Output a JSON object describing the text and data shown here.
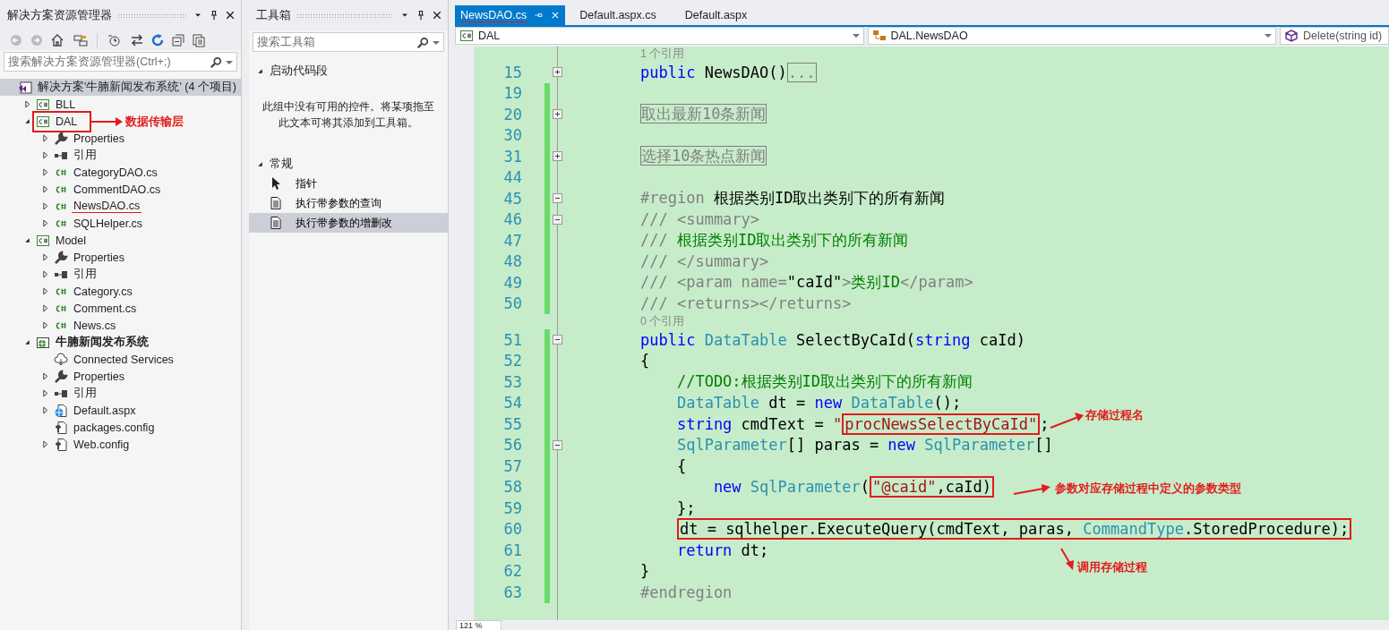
{
  "solution_explorer": {
    "title": "解决方案资源管理器",
    "search": {
      "placeholder": "搜索解决方案资源管理器(Ctrl+;)"
    },
    "tree": [
      {
        "label": "解决方案'牛腩新闻发布系统' (4 个项目)",
        "kind": "solution",
        "selected": true,
        "children": [
          {
            "label": "BLL",
            "kind": "csproj",
            "expanded": false
          },
          {
            "label": "DAL",
            "kind": "csproj",
            "expanded": true,
            "boxed": true,
            "children": [
              {
                "label": "Properties",
                "kind": "wrench",
                "expanded": false
              },
              {
                "label": "引用",
                "kind": "reference",
                "expanded": false
              },
              {
                "label": "CategoryDAO.cs",
                "kind": "csfile",
                "expanded": false
              },
              {
                "label": "CommentDAO.cs",
                "kind": "csfile",
                "expanded": false
              },
              {
                "label": "NewsDAO.cs",
                "kind": "csfile",
                "expanded": false,
                "underlined": true
              },
              {
                "label": "SQLHelper.cs",
                "kind": "csfile",
                "expanded": false
              }
            ]
          },
          {
            "label": "Model",
            "kind": "csproj",
            "expanded": true,
            "children": [
              {
                "label": "Properties",
                "kind": "wrench",
                "expanded": false
              },
              {
                "label": "引用",
                "kind": "reference",
                "expanded": false
              },
              {
                "label": "Category.cs",
                "kind": "csfile",
                "expanded": false
              },
              {
                "label": "Comment.cs",
                "kind": "csfile",
                "expanded": false
              },
              {
                "label": "News.cs",
                "kind": "csfile",
                "expanded": false
              }
            ]
          },
          {
            "label": "牛腩新闻发布系统",
            "kind": "webproj",
            "expanded": true,
            "bold": true,
            "children": [
              {
                "label": "Connected Services",
                "kind": "cloud"
              },
              {
                "label": "Properties",
                "kind": "wrench",
                "expanded": false
              },
              {
                "label": "引用",
                "kind": "reference",
                "expanded": false
              },
              {
                "label": "Default.aspx",
                "kind": "webfile",
                "expanded": false
              },
              {
                "label": "packages.config",
                "kind": "config"
              },
              {
                "label": "Web.config",
                "kind": "config",
                "expanded": false
              }
            ]
          }
        ]
      }
    ]
  },
  "toolbox": {
    "title": "工具箱",
    "search": {
      "placeholder": "搜索工具箱"
    },
    "groups": [
      {
        "label": "启动代码段",
        "expanded": true,
        "message": "此组中没有可用的控件。将某项拖至此文本可将其添加到工具箱。"
      },
      {
        "label": "常规",
        "expanded": true,
        "items": [
          {
            "label": "指针",
            "kind": "pointer",
            "selected": false
          },
          {
            "label": "执行带参数的查询",
            "kind": "snippet",
            "selected": false
          },
          {
            "label": "执行带参数的增删改",
            "kind": "snippet",
            "selected": true
          }
        ]
      }
    ]
  },
  "editor": {
    "tabs": [
      {
        "label": "NewsDAO.cs",
        "selected": true,
        "underlined": true
      },
      {
        "label": "Default.aspx.cs",
        "selected": false
      },
      {
        "label": "Default.aspx",
        "selected": false
      }
    ],
    "navigation": [
      {
        "kind": "project",
        "text": "DAL"
      },
      {
        "kind": "class",
        "text": "DAL.NewsDAO"
      },
      {
        "kind": "member",
        "text": "Delete(string id)"
      }
    ],
    "lines": [
      {
        "kind": "hint",
        "text": "1 个引用"
      },
      {
        "kind": "code",
        "number": "15",
        "expanded": false,
        "changed": false,
        "segments": [
          {
            "kind": "kw",
            "text": "public "
          },
          {
            "kind": "plain",
            "text": "NewsDAO()"
          },
          {
            "kind": "collapsed",
            "text": "..."
          }
        ]
      },
      {
        "kind": "code",
        "number": "19",
        "changed": true
      },
      {
        "kind": "code",
        "number": "20",
        "expanded": false,
        "changed": true,
        "segments": [
          {
            "kind": "collapsed",
            "text": "取出最新10条新闻"
          }
        ]
      },
      {
        "kind": "code",
        "number": "30",
        "changed": true
      },
      {
        "kind": "code",
        "number": "31",
        "expanded": false,
        "changed": true,
        "segments": [
          {
            "kind": "collapsed",
            "text": "选择10条热点新闻"
          }
        ]
      },
      {
        "kind": "code",
        "number": "44",
        "changed": true
      },
      {
        "kind": "code",
        "number": "45",
        "expanded": true,
        "changed": true,
        "segments": [
          {
            "kind": "gray",
            "text": "#region "
          },
          {
            "kind": "plain",
            "text": "根据类别ID取出类别下的所有新闻"
          }
        ]
      },
      {
        "kind": "code",
        "number": "46",
        "expanded": true,
        "changed": true,
        "segments": [
          {
            "kind": "gray",
            "text": "/// <summary>"
          }
        ]
      },
      {
        "kind": "code",
        "number": "47",
        "changed": true,
        "segments": [
          {
            "kind": "gray",
            "text": "/// "
          },
          {
            "kind": "comment",
            "text": "根据类别ID取出类别下的所有新闻"
          }
        ]
      },
      {
        "kind": "code",
        "number": "48",
        "changed": true,
        "segments": [
          {
            "kind": "gray",
            "text": "/// </summary>"
          }
        ]
      },
      {
        "kind": "code",
        "number": "49",
        "changed": true,
        "segments": [
          {
            "kind": "gray",
            "text": "/// <param name="
          },
          {
            "kind": "plain",
            "text": "\"caId\""
          },
          {
            "kind": "gray",
            "text": ">"
          },
          {
            "kind": "comment",
            "text": "类别ID"
          },
          {
            "kind": "gray",
            "text": "</param>"
          }
        ]
      },
      {
        "kind": "code",
        "number": "50",
        "changed": true,
        "segments": [
          {
            "kind": "gray",
            "text": "/// <returns></returns>"
          }
        ]
      },
      {
        "kind": "hint",
        "text": "0 个引用"
      },
      {
        "kind": "code",
        "number": "51",
        "expanded": true,
        "changed": true,
        "segments": [
          {
            "kind": "kw",
            "text": "public "
          },
          {
            "kind": "type",
            "text": "DataTable"
          },
          {
            "kind": "plain",
            "text": " SelectByCaId("
          },
          {
            "kind": "kw",
            "text": "string"
          },
          {
            "kind": "plain",
            "text": " caId)"
          }
        ]
      },
      {
        "kind": "code",
        "number": "52",
        "changed": true,
        "segments": [
          {
            "kind": "plain",
            "text": "{"
          }
        ]
      },
      {
        "kind": "code",
        "number": "53",
        "changed": true,
        "segments": [
          {
            "kind": "comment",
            "text": "    //TODO:根据类别ID取出类别下的所有新闻"
          }
        ]
      },
      {
        "kind": "code",
        "number": "54",
        "changed": true,
        "segments": [
          {
            "kind": "type",
            "text": "    DataTable"
          },
          {
            "kind": "plain",
            "text": " dt = "
          },
          {
            "kind": "kw",
            "text": "new "
          },
          {
            "kind": "type",
            "text": "DataTable"
          },
          {
            "kind": "plain",
            "text": "();"
          }
        ]
      },
      {
        "kind": "code",
        "number": "55",
        "changed": true,
        "segments": [
          {
            "kind": "kw",
            "text": "    string"
          },
          {
            "kind": "plain",
            "text": " cmdText = "
          },
          {
            "kind": "string",
            "text": "\""
          },
          {
            "kind": "box",
            "children": [
              {
                "kind": "string",
                "text": "procNewsSelectByCaId\""
              }
            ]
          },
          {
            "kind": "plain",
            "text": ";"
          }
        ]
      },
      {
        "kind": "code",
        "number": "56",
        "expanded": true,
        "changed": true,
        "segments": [
          {
            "kind": "type",
            "text": "    SqlParameter"
          },
          {
            "kind": "plain",
            "text": "[] paras = "
          },
          {
            "kind": "kw",
            "text": "new "
          },
          {
            "kind": "type",
            "text": "SqlParameter"
          },
          {
            "kind": "plain",
            "text": "[]"
          }
        ]
      },
      {
        "kind": "code",
        "number": "57",
        "changed": true,
        "segments": [
          {
            "kind": "plain",
            "text": "    {"
          }
        ]
      },
      {
        "kind": "code",
        "number": "58",
        "changed": true,
        "segments": [
          {
            "kind": "kw",
            "text": "        new "
          },
          {
            "kind": "type",
            "text": "SqlParameter"
          },
          {
            "kind": "plain",
            "text": "("
          },
          {
            "kind": "box",
            "children": [
              {
                "kind": "string",
                "text": "\"@caid\""
              },
              {
                "kind": "plain",
                "text": ",caId)"
              }
            ]
          }
        ]
      },
      {
        "kind": "code",
        "number": "59",
        "changed": true,
        "segments": [
          {
            "kind": "plain",
            "text": "    };"
          }
        ]
      },
      {
        "kind": "code",
        "number": "60",
        "changed": true,
        "segments": [
          {
            "kind": "box",
            "children": [
              {
                "kind": "plain",
                "text": "    dt = sqlhelper.ExecuteQuery(cmdText, paras, "
              },
              {
                "kind": "type",
                "text": "CommandType"
              },
              {
                "kind": "plain",
                "text": ".StoredProcedure);"
              }
            ]
          }
        ]
      },
      {
        "kind": "code",
        "number": "61",
        "changed": true,
        "segments": [
          {
            "kind": "kw",
            "text": "    return"
          },
          {
            "kind": "plain",
            "text": " dt;"
          }
        ]
      },
      {
        "kind": "code",
        "number": "62",
        "changed": true,
        "segments": [
          {
            "kind": "plain",
            "text": "}"
          }
        ]
      },
      {
        "kind": "code",
        "number": "63",
        "changed": true,
        "segments": [
          {
            "kind": "gray",
            "text": "#endregion"
          }
        ]
      }
    ],
    "zoom": "121 %"
  },
  "annotations": [
    {
      "text": "数据传输层"
    },
    {
      "text": "存储过程名"
    },
    {
      "text": "参数对应存储过程中定义的参数类型"
    },
    {
      "text": "调用存储过程"
    }
  ]
}
